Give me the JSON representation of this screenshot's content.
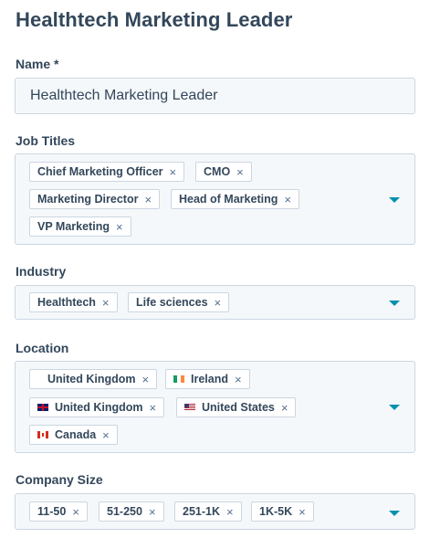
{
  "form": {
    "title": "Healthtech Marketing Leader",
    "name": {
      "label": "Name *",
      "value": "Healthtech Marketing Leader"
    },
    "job_titles": {
      "label": "Job Titles",
      "tags": [
        "Chief Marketing Officer",
        "CMO",
        "Marketing Director",
        "Head of Marketing",
        "VP Marketing"
      ]
    },
    "industry": {
      "label": "Industry",
      "tags": [
        "Healthtech",
        "Life sciences"
      ]
    },
    "location": {
      "label": "Location",
      "tags": [
        {
          "label": "United Kingdom",
          "flag": ""
        },
        {
          "label": "Ireland",
          "flag": "ireland-flag-icon"
        },
        {
          "label": "United Kingdom",
          "flag": "uk-flag-icon"
        },
        {
          "label": "United States",
          "flag": "us-flag-icon"
        },
        {
          "label": "Canada",
          "flag": "canada-flag-icon"
        }
      ]
    },
    "company_size": {
      "label": "Company Size",
      "tags": [
        "11-50",
        "51-250",
        "251-1K",
        "1K-5K"
      ]
    },
    "remove_glyph": "×",
    "colors": {
      "accent": "#0091ae",
      "text": "#33475b",
      "field_bg": "#f5f8fa",
      "border": "#cbd6e2"
    }
  }
}
